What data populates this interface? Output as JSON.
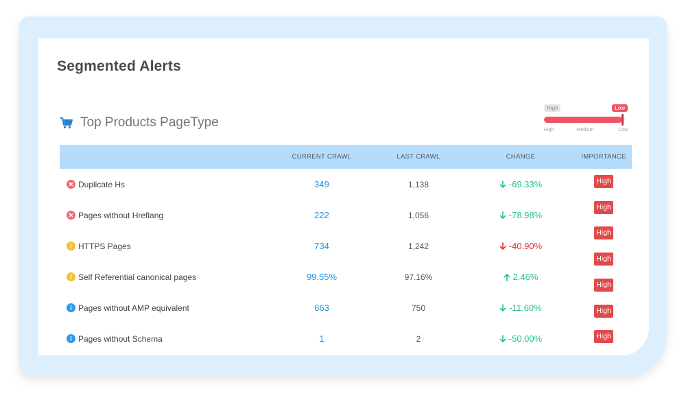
{
  "page": {
    "title": "Segmented Alerts"
  },
  "section": {
    "title": "Top Products PageType",
    "icon": "cart-icon"
  },
  "legend": {
    "tag_high": "High",
    "tag_low": "Low",
    "scale": [
      "High",
      "Medium",
      "Low"
    ],
    "level": 0.97
  },
  "table": {
    "headers": [
      "CURRENT CRAWL",
      "LAST CRAWL",
      "CHANGE",
      "IMPORTANCE"
    ],
    "rows": [
      {
        "status": "error",
        "name": "Duplicate Hs",
        "current": "349",
        "last": "1,138",
        "change": "-69.33%",
        "direction": "down",
        "tone": "good"
      },
      {
        "status": "error",
        "name": "Pages without Hreflang",
        "current": "222",
        "last": "1,056",
        "change": "-78.98%",
        "direction": "down",
        "tone": "good"
      },
      {
        "status": "warning",
        "name": "HTTPS Pages",
        "current": "734",
        "last": "1,242",
        "change": "-40.90%",
        "direction": "down",
        "tone": "bad"
      },
      {
        "status": "warning",
        "name": "Self Referential canonical pages",
        "current": "99.55%",
        "last": "97.16%",
        "change": "2.46%",
        "direction": "up",
        "tone": "good"
      },
      {
        "status": "info",
        "name": "Pages without AMP equivalent",
        "current": "663",
        "last": "750",
        "change": "-11.60%",
        "direction": "down",
        "tone": "good"
      },
      {
        "status": "info",
        "name": "Pages without Schema",
        "current": "1",
        "last": "2",
        "change": "-50.00%",
        "direction": "down",
        "tone": "good"
      }
    ],
    "importance_badges": [
      "High",
      "High",
      "High",
      "High",
      "High",
      "High",
      "High"
    ]
  },
  "colors": {
    "error": "#ef6b78",
    "warning": "#f6c02d",
    "info": "#2f9ae8",
    "accent": "#ee5466",
    "header_bg": "#b6dcfb"
  }
}
